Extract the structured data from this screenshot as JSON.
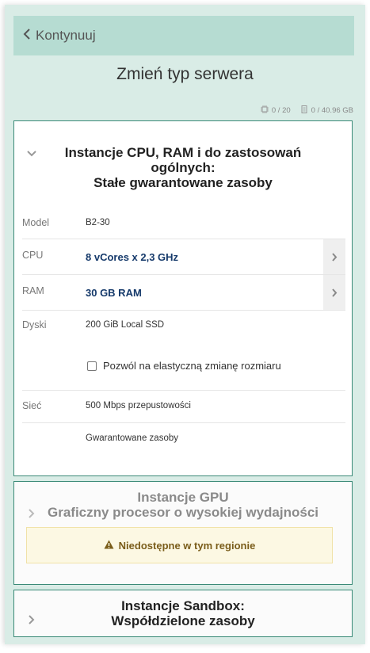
{
  "header": {
    "back_label": "Kontynuuj",
    "title": "Zmień typ serwera"
  },
  "quota": {
    "instances": "0 / 20",
    "storage": "0 / 40.96 GB"
  },
  "general_card": {
    "title_line1": "Instancje CPU, RAM i do zastosowań",
    "title_line2": "ogólnych:",
    "title_line3": "Stałe gwarantowane zasoby",
    "rows": {
      "model": {
        "label": "Model",
        "value": "B2-30"
      },
      "cpu": {
        "label": "CPU",
        "value": "8 vCores x 2,3 GHz"
      },
      "ram": {
        "label": "RAM",
        "value": "30 GB RAM"
      },
      "disks": {
        "label": "Dyski",
        "value": "200 GiB Local SSD"
      },
      "resize_checkbox": {
        "label": "Pozwól na elastyczną zmianę rozmiaru",
        "checked": false
      },
      "network": {
        "label": "Sieć",
        "value": "500 Mbps przepustowości"
      },
      "guarantee": {
        "value": "Gwarantowane zasoby"
      }
    }
  },
  "gpu_card": {
    "title_line1": "Instancje GPU",
    "title_line2": "Graficzny procesor o wysokiej wydajności",
    "warning": "Niedostępne w tym regionie"
  },
  "sandbox_card": {
    "title_line1": "Instancje Sandbox:",
    "title_line2": "Współdzielone zasoby"
  },
  "colors": {
    "panel_bg": "#d9ece6",
    "topbar_bg": "#b6dcd2",
    "card_border": "#3a8a77",
    "selected_value": "#163a6b",
    "warning_bg": "#fcf8e3"
  }
}
